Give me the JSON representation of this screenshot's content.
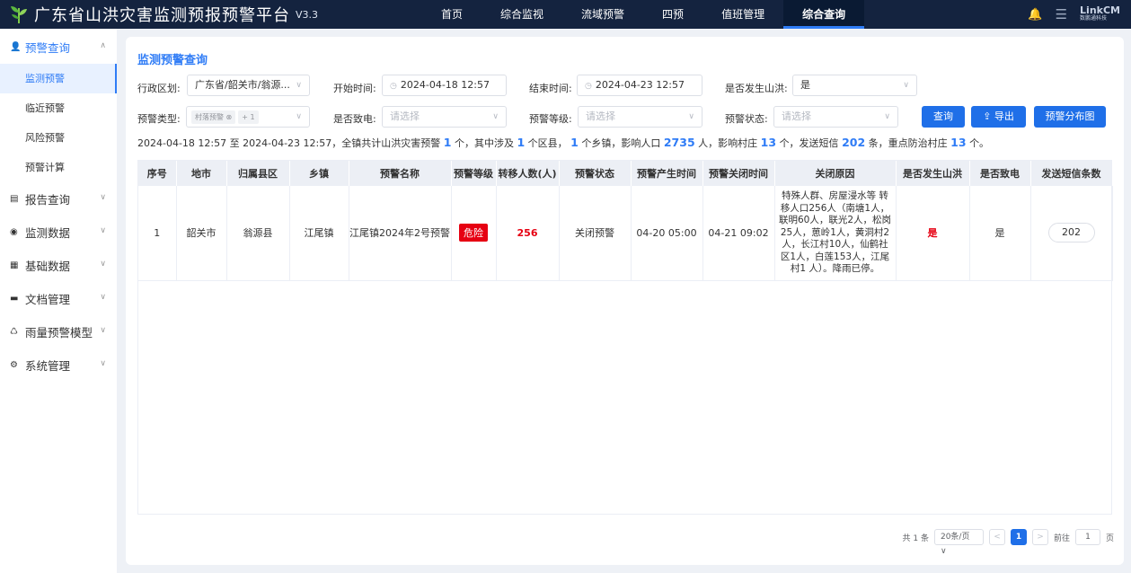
{
  "header": {
    "title": "广东省山洪灾害监测预报预警平台",
    "version": "V3.3",
    "nav": [
      {
        "label": "首页"
      },
      {
        "label": "综合监视"
      },
      {
        "label": "流域预警"
      },
      {
        "label": "四预"
      },
      {
        "label": "值班管理"
      },
      {
        "label": "综合查询"
      }
    ],
    "active_nav": "综合查询",
    "brand_line1": "LinkCM",
    "brand_line2": "数鹏通科技",
    "accent_color": "#2f7cf6",
    "bar_color": "#14233f"
  },
  "sidebar": {
    "groups": [
      {
        "label": "预警查询",
        "icon": "alert-user-icon",
        "open": true,
        "items": [
          {
            "label": "监测预警",
            "active": true
          },
          {
            "label": "临近预警"
          },
          {
            "label": "风险预警"
          },
          {
            "label": "预警计算"
          }
        ]
      },
      {
        "label": "报告查询",
        "icon": "report-icon"
      },
      {
        "label": "监测数据",
        "icon": "location-icon"
      },
      {
        "label": "基础数据",
        "icon": "database-icon"
      },
      {
        "label": "文档管理",
        "icon": "folder-icon"
      },
      {
        "label": "雨量预警模型",
        "icon": "recycle-icon"
      },
      {
        "label": "系统管理",
        "icon": "gear-icon"
      }
    ]
  },
  "main": {
    "title": "监测预警查询",
    "filters": {
      "region_label": "行政区划:",
      "region_value": "广东省/韶关市/翁源...",
      "start_label": "开始时间:",
      "start_value": "2024-04-18 12:57",
      "end_label": "结束时间:",
      "end_value": "2024-04-23 12:57",
      "flood_label": "是否发生山洪:",
      "flood_value": "是",
      "type_label": "预警类型:",
      "type_tag": "村落预警",
      "type_more": "+ 1",
      "power_label": "是否致电:",
      "power_placeholder": "请选择",
      "level_label": "预警等级:",
      "level_placeholder": "请选择",
      "status_label": "预警状态:",
      "status_placeholder": "请选择"
    },
    "buttons": {
      "query": "查询",
      "export": "导出",
      "map": "预警分布图"
    },
    "summary": {
      "p1": "2024-04-18 12:57 至 2024-04-23 12:57，全镇共计山洪灾害预警",
      "n1": "1",
      "p2": "个，其中涉及",
      "n2": "1",
      "p3": "个区县，",
      "n3": "1",
      "p4": "个乡镇，影响人口",
      "n4": "2735",
      "p5": "人，影响村庄",
      "n5": "13",
      "p6": "个，发送短信",
      "n6": "202",
      "p7": "条，重点防治村庄",
      "n7": "13",
      "p8": "个。"
    },
    "table": {
      "headers": [
        "序号",
        "地市",
        "归属县区",
        "乡镇",
        "预警名称",
        "预警等级",
        "转移人数(人)",
        "预警状态",
        "预警产生时间",
        "预警关闭时间",
        "关闭原因",
        "是否发生山洪",
        "是否致电",
        "发送短信条数"
      ],
      "rows": [
        {
          "index": "1",
          "city": "韶关市",
          "county": "翁源县",
          "town": "江尾镇",
          "name": "江尾镇2024年2号预警",
          "level": "危险",
          "moved": "256",
          "status": "关闭预警",
          "start": "04-20 05:00",
          "end": "04-21 09:02",
          "reason": "特殊人群、房屋浸水等 转移人口256人（南塘1人，联明60人，联光2人，松岗25人，葸岭1人，黄洞村2人，长江村10人，仙鹤社区1人，白莲153人，江尾村1 人）。降雨已停。",
          "flood": "是",
          "power": "是",
          "sms": "202"
        }
      ]
    },
    "pager": {
      "total": "共 1 条",
      "size": "20条/页",
      "current": "1",
      "goto_label": "前往",
      "goto_value": "1",
      "page_unit": "页"
    }
  }
}
